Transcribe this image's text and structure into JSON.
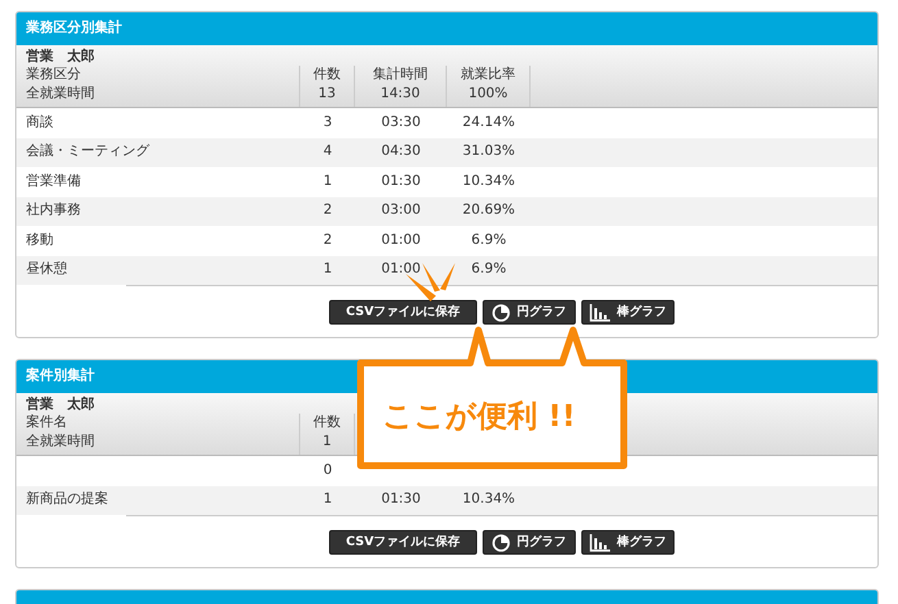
{
  "panels": [
    {
      "title": "業務区分別集計",
      "person": "営業　太郎",
      "columns": [
        {
          "label": "業務区分",
          "total": "全就業時間"
        },
        {
          "label": "件数",
          "total": "13"
        },
        {
          "label": "集計時間",
          "total": "14:30"
        },
        {
          "label": "就業比率",
          "total": "100%"
        }
      ],
      "rows": [
        {
          "name": "商談",
          "count": "3",
          "time": "03:30",
          "ratio": "24.14%"
        },
        {
          "name": "会議・ミーティング",
          "count": "4",
          "time": "04:30",
          "ratio": "31.03%"
        },
        {
          "name": "営業準備",
          "count": "1",
          "time": "01:30",
          "ratio": "10.34%"
        },
        {
          "name": "社内事務",
          "count": "2",
          "time": "03:00",
          "ratio": "20.69%"
        },
        {
          "name": "移動",
          "count": "2",
          "time": "01:00",
          "ratio": "6.9%"
        },
        {
          "name": "昼休憩",
          "count": "1",
          "time": "01:00",
          "ratio": "6.9%"
        }
      ],
      "buttons": [
        {
          "kind": "csv",
          "label": "CSVファイルに保存"
        },
        {
          "kind": "pie",
          "label": "円グラフ"
        },
        {
          "kind": "bar",
          "label": "棒グラフ"
        }
      ]
    },
    {
      "title": "案件別集計",
      "person": "営業　太郎",
      "columns": [
        {
          "label": "案件名",
          "total": "全就業時間"
        },
        {
          "label": "件数",
          "total": "1"
        }
      ],
      "rows": [
        {
          "count": "0"
        },
        {
          "name": "新商品の提案",
          "count": "1",
          "time": "01:30",
          "ratio": "10.34%"
        }
      ],
      "buttons": [
        {
          "kind": "csv",
          "label": "CSVファイルに保存"
        },
        {
          "kind": "pie",
          "label": "円グラフ"
        },
        {
          "kind": "bar",
          "label": "棒グラフ"
        }
      ]
    },
    {
      "kind": "cut"
    }
  ],
  "callout": {
    "text": "ここが便利 !!"
  }
}
